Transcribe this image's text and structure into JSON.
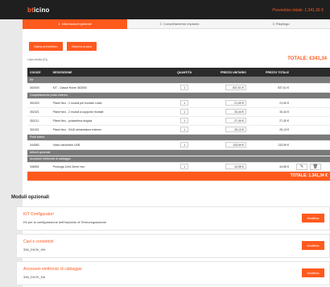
{
  "header": {
    "logo_prefix": "bt",
    "logo_rest": "icino",
    "right_text": "Preventivo totale: 1.341,36 €"
  },
  "steps": [
    "1. Informazioni generali",
    "2. Completamento impianto",
    "3. Riepilogo"
  ],
  "actions": {
    "download": "Salva preventivo",
    "new": "Genera nuovo"
  },
  "list_label": "Lista ridotta (01)",
  "total_top": "TOTALE: €341,34",
  "table": {
    "headers": [
      "CODICE",
      "DESCRIZIONE",
      "QUANTITÀ",
      "PREZZO UNITARIO",
      "PREZZO TOTALE"
    ],
    "sections": [
      {
        "title": "Kit",
        "rows": [
          {
            "code": "363000",
            "desc": "KIT - Classe Home 363000",
            "qty": "1",
            "price": "837,51 €",
            "total": "837,51 €"
          }
        ]
      },
      {
        "title": "Completamento posto esterno",
        "rows": [
          {
            "code": "352320",
            "desc": "Pláné Neo - 2 moduli per frontale Linea",
            "qty": "1",
            "price": "21,90 €",
            "total": "21,90 €"
          },
          {
            "code": "352321",
            "desc": "Pláné Neo - 2 moduli a supporto frontale",
            "qty": "1",
            "price": "33,44 €",
            "total": "33,44 €"
          },
          {
            "code": "352111",
            "desc": "Pláné Neo - pulsantiera singola",
            "qty": "1",
            "price": "27,40 €",
            "total": "27,40 €"
          },
          {
            "code": "352401",
            "desc": "Pláné Neo - SAID alimentatore esterno",
            "qty": "1",
            "price": "25,13 €",
            "total": "25,13 €"
          }
        ]
      },
      {
        "title": "Posti interni",
        "rows": [
          {
            "code": "344582",
            "desc": "Video handsfree USB",
            "qty": "1",
            "price": "133,59 €",
            "total": "133,59 €"
          }
        ]
      },
      {
        "title": "Articoli opzionali",
        "rows": []
      },
      {
        "title": "Accessori elettronici di cablaggio",
        "rows": [
          {
            "code": "336591",
            "desc": "Prolunga 10mt Zener hex",
            "qty": "1",
            "price": "44,55 €",
            "total": "44,55 €"
          }
        ]
      }
    ],
    "total_label": "TOTALE: 1.341,34 €"
  },
  "modules": {
    "title": "Moduli opzionali",
    "items": [
      {
        "title": "KIT Configuratori",
        "sub": "Kit per la configurazione dell'impianto di Termoregolazione",
        "btn": "Modifica"
      },
      {
        "title": "Cavi e connettori",
        "sub": "336_DIVIV_HH",
        "btn": "Modifica"
      },
      {
        "title": "Accessori elettronici di cablaggio",
        "sub": "336_DIVIV_HA",
        "btn": "Modifica"
      }
    ]
  }
}
